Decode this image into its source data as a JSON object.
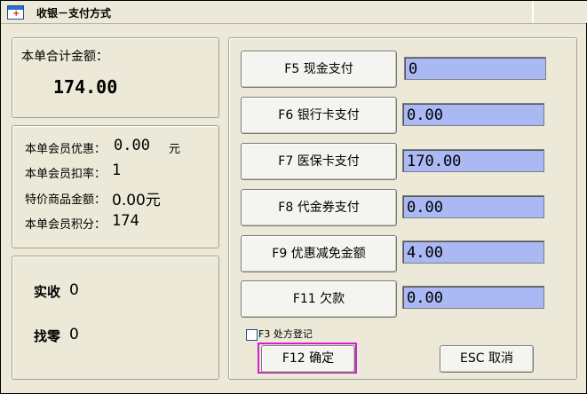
{
  "window": {
    "title": "收银－支付方式"
  },
  "total": {
    "label": "本单合计金额：",
    "amount": "174.00"
  },
  "member": {
    "discount_label": "本单会员优惠：",
    "discount_value": "0.00",
    "discount_unit": "元",
    "rate_label": "本单会员扣率：",
    "rate_value": "1",
    "special_label": "特价商品金额：",
    "special_value": "0.00元",
    "points_label": "本单会员积分：",
    "points_value": "174"
  },
  "payment": {
    "received_label": "实收",
    "received_value": "0",
    "change_label": "找零",
    "change_value": "0"
  },
  "methods": [
    {
      "label": "F5 现金支付",
      "value": "0"
    },
    {
      "label": "F6 银行卡支付",
      "value": "0.00"
    },
    {
      "label": "F7 医保卡支付",
      "value": "170.00"
    },
    {
      "label": "F8 代金券支付",
      "value": "0.00"
    },
    {
      "label": "F9 优惠减免金额",
      "value": "4.00"
    },
    {
      "label": "F11 欠款",
      "value": "0.00"
    }
  ],
  "prescription": {
    "label": "F3 处方登记",
    "checked": false
  },
  "actions": {
    "confirm": "F12 确定",
    "cancel": "ESC 取消"
  }
}
